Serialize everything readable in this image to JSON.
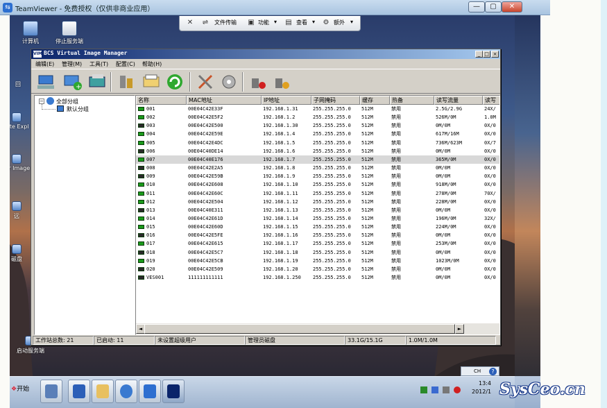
{
  "teamviewer": {
    "title": "TeamViewer - 免费授权（仅供非商业应用）",
    "min": "—",
    "max": "▢",
    "close": "✕",
    "toolbar": {
      "close": "✕",
      "file_transfer": "文件传输",
      "function": "功能",
      "view": "查看",
      "extras": "额外",
      "dropdown": "▾"
    }
  },
  "desktop_icons": [
    {
      "label": "计算机"
    },
    {
      "label": "停止服务端"
    },
    {
      "label": "回"
    },
    {
      "label": "Inte Expl"
    },
    {
      "label": "Vir Image"
    },
    {
      "label": "远"
    },
    {
      "label": "磁盘"
    },
    {
      "label": "启动服务端"
    }
  ],
  "vim": {
    "logo": "VIM",
    "title": "BCS Virtual Image Manager",
    "min": "_",
    "max": "□",
    "close": "×",
    "menu": [
      {
        "label": "编辑(E)"
      },
      {
        "label": "管理(M)"
      },
      {
        "label": "工具(T)"
      },
      {
        "label": "配置(C)"
      },
      {
        "label": "帮助(H)"
      }
    ],
    "tree": {
      "root": "全部分组",
      "child": "默认分组",
      "expander": "−"
    },
    "columns": [
      "名称",
      "MAC地址",
      "IP地址",
      "子网掩码",
      "缓存",
      "热备",
      "读写流量",
      "读写"
    ],
    "rows": [
      {
        "name": "001",
        "mac": "00E04C42E33F",
        "ip": "192.168.1.31",
        "mask": "255.255.255.0",
        "cache": "512M",
        "hot": "禁用",
        "traffic": "2.5G/2.9G",
        "rw": "24X/",
        "on": true
      },
      {
        "name": "002",
        "mac": "00E04C42E5F2",
        "ip": "192.168.1.2",
        "mask": "255.255.255.0",
        "cache": "512M",
        "hot": "禁用",
        "traffic": "526M/0M",
        "rw": "1.0M",
        "on": true
      },
      {
        "name": "003",
        "mac": "00E04C42E500",
        "ip": "192.168.1.30",
        "mask": "255.255.255.0",
        "cache": "512M",
        "hot": "禁用",
        "traffic": "0M/0M",
        "rw": "0X/0",
        "on": false
      },
      {
        "name": "004",
        "mac": "00E04C42E59E",
        "ip": "192.168.1.4",
        "mask": "255.255.255.0",
        "cache": "512M",
        "hot": "禁用",
        "traffic": "617M/16M",
        "rw": "0X/0",
        "on": true
      },
      {
        "name": "005",
        "mac": "00E04C42E4DC",
        "ip": "192.168.1.5",
        "mask": "255.255.255.0",
        "cache": "512M",
        "hot": "禁用",
        "traffic": "736M/623M",
        "rw": "0X/7",
        "on": true
      },
      {
        "name": "006",
        "mac": "00E04C40DE14",
        "ip": "192.168.1.6",
        "mask": "255.255.255.0",
        "cache": "512M",
        "hot": "禁用",
        "traffic": "0M/0M",
        "rw": "0X/0",
        "on": false
      },
      {
        "name": "007",
        "mac": "00E04C40E176",
        "ip": "192.168.1.7",
        "mask": "255.255.255.0",
        "cache": "512M",
        "hot": "禁用",
        "traffic": "365M/0M",
        "rw": "0X/0",
        "on": true
      },
      {
        "name": "008",
        "mac": "00E04C42E2A5",
        "ip": "192.168.1.8",
        "mask": "255.255.255.0",
        "cache": "512M",
        "hot": "禁用",
        "traffic": "0M/0M",
        "rw": "0X/0",
        "on": false
      },
      {
        "name": "009",
        "mac": "00E04C42E59B",
        "ip": "192.168.1.9",
        "mask": "255.255.255.0",
        "cache": "512M",
        "hot": "禁用",
        "traffic": "0M/0M",
        "rw": "0X/0",
        "on": false
      },
      {
        "name": "010",
        "mac": "00E04C42E608",
        "ip": "192.168.1.10",
        "mask": "255.255.255.0",
        "cache": "512M",
        "hot": "禁用",
        "traffic": "918M/0M",
        "rw": "0X/0",
        "on": true
      },
      {
        "name": "011",
        "mac": "00E04C42E60C",
        "ip": "192.168.1.11",
        "mask": "255.255.255.0",
        "cache": "512M",
        "hot": "禁用",
        "traffic": "278M/0M",
        "rw": "70X/",
        "on": true
      },
      {
        "name": "012",
        "mac": "00E04C42E504",
        "ip": "192.168.1.12",
        "mask": "255.255.255.0",
        "cache": "512M",
        "hot": "禁用",
        "traffic": "228M/0M",
        "rw": "0X/0",
        "on": true
      },
      {
        "name": "013",
        "mac": "00E04C40E311",
        "ip": "192.168.1.13",
        "mask": "255.255.255.0",
        "cache": "512M",
        "hot": "禁用",
        "traffic": "0M/0M",
        "rw": "0X/0",
        "on": false
      },
      {
        "name": "014",
        "mac": "00E04C42E61D",
        "ip": "192.168.1.14",
        "mask": "255.255.255.0",
        "cache": "512M",
        "hot": "禁用",
        "traffic": "196M/0M",
        "rw": "32X/",
        "on": true
      },
      {
        "name": "015",
        "mac": "00E04C42E60D",
        "ip": "192.168.1.15",
        "mask": "255.255.255.0",
        "cache": "512M",
        "hot": "禁用",
        "traffic": "224M/0M",
        "rw": "0X/0",
        "on": true
      },
      {
        "name": "016",
        "mac": "00E04C42E5FE",
        "ip": "192.168.1.16",
        "mask": "255.255.255.0",
        "cache": "512M",
        "hot": "禁用",
        "traffic": "0M/0M",
        "rw": "0X/0",
        "on": false
      },
      {
        "name": "017",
        "mac": "00E04C42E615",
        "ip": "192.168.1.17",
        "mask": "255.255.255.0",
        "cache": "512M",
        "hot": "禁用",
        "traffic": "253M/0M",
        "rw": "0X/0",
        "on": true
      },
      {
        "name": "018",
        "mac": "00E04C42E5C7",
        "ip": "192.168.1.18",
        "mask": "255.255.255.0",
        "cache": "512M",
        "hot": "禁用",
        "traffic": "0M/0M",
        "rw": "0X/0",
        "on": false
      },
      {
        "name": "019",
        "mac": "00E04C42E5CB",
        "ip": "192.168.1.19",
        "mask": "255.255.255.0",
        "cache": "512M",
        "hot": "禁用",
        "traffic": "1023M/0M",
        "rw": "0X/0",
        "on": true
      },
      {
        "name": "020",
        "mac": "00E04C42E509",
        "ip": "192.168.1.20",
        "mask": "255.255.255.0",
        "cache": "512M",
        "hot": "禁用",
        "traffic": "0M/0M",
        "rw": "0X/0",
        "on": false
      },
      {
        "name": "VES001",
        "mac": "111111111111",
        "ip": "192.168.1.250",
        "mask": "255.255.255.0",
        "cache": "512M",
        "hot": "禁用",
        "traffic": "0M/0M",
        "rw": "0X/0",
        "on": false
      }
    ],
    "selected_row": 6,
    "scroll_left": "◄",
    "scroll_right": "►",
    "status": {
      "total": "工作站总数: 21",
      "started": "已启动: 11",
      "superuser": "未设置超级用户",
      "disk": "管理员磁盘",
      "space": "33.1G/15.1G",
      "rate": "1.0M/1.0M"
    }
  },
  "taskbar": {
    "start": "开始",
    "lang": "CH",
    "clock_time": "13:4",
    "clock_date": "2012/1"
  },
  "watermark": "SysCeo.cn",
  "colors": {
    "win2k_face": "#d4d0c8",
    "title_active": "#0a246a",
    "online_green": "#1a9a1a"
  }
}
